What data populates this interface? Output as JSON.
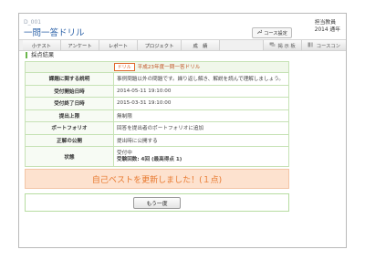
{
  "header": {
    "code": "D_001",
    "title": "一問一答ドリル",
    "user_role": "担当教員",
    "user_year": "2014 通年",
    "course_button": "コース設定"
  },
  "nav": {
    "tabs": [
      "小テスト",
      "アンケート",
      "レポート",
      "プロジェクト",
      "成　績"
    ],
    "right_items": [
      "掲 示 板",
      "コースコン"
    ]
  },
  "section_title": "採点結果",
  "drill": {
    "tag": "ドリル",
    "name": "平成23年度一問一答ドリル"
  },
  "rows": [
    {
      "label": "課題に関する説明",
      "value": "事例問題以外の問題です。繰り返し解き、解説を読んで理解しましょう。"
    },
    {
      "label": "受付開始日時",
      "value": "2014-05-11 19:10:00"
    },
    {
      "label": "受付終了日時",
      "value": "2015-03-31 19:10:00"
    },
    {
      "label": "提出上限",
      "value": "無制限"
    },
    {
      "label": "ポートフォリオ",
      "value": "回答を提出者のポートフォリオに追加"
    },
    {
      "label": "正解の公開",
      "value": "提出時に公開する"
    }
  ],
  "status": {
    "label": "状態",
    "line1": "受付中",
    "line2": "受験回数: 4回 (最高得点 1)"
  },
  "banner": "自己ベストを更新しました！(１点)",
  "again_button": "もう一度"
}
